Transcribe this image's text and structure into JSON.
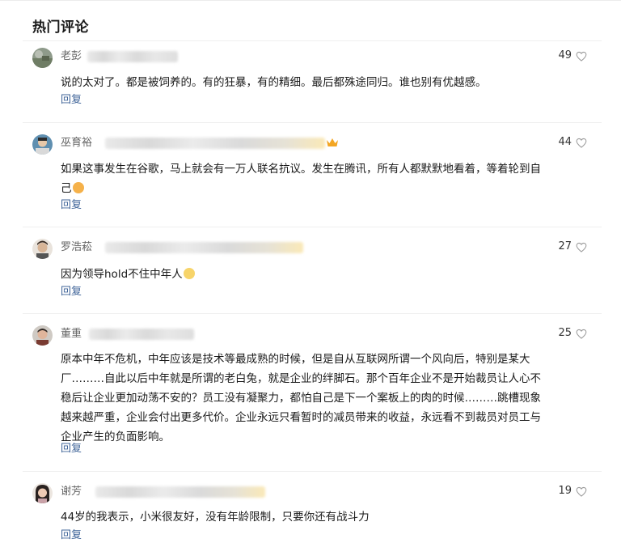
{
  "section": {
    "title": "热门评论"
  },
  "comments": [
    {
      "username": "老彭",
      "likes": "49",
      "content": "说的太对了。都是被饲养的。有的狂暴，有的精细。最后都殊途同归。谁也别有优越感。",
      "reply": "回复"
    },
    {
      "username": "巫育裕",
      "likes": "44",
      "content": "如果这事发生在谷歌，马上就会有一万人联名抗议。发生在腾讯，所有人都默默地看着，等着轮到自己",
      "reply": "回复",
      "badge": "crown-icon",
      "emoji": "crying-face-emoji"
    },
    {
      "username": "罗浩菘",
      "likes": "27",
      "content": "因为领导hold不住中年人",
      "reply": "回复",
      "emoji": "smirk-face-emoji"
    },
    {
      "username": "董重",
      "likes": "25",
      "content": "原本中年不危机，中年应该是技术等最成熟的时候，但是自从互联网所谓一个风向后，特别是某大厂………自此以后中年就是所谓的老白兔，就是企业的绊脚石。那个百年企业不是开始裁员让人心不稳后让企业更加动荡不安的？员工没有凝聚力，都怕自己是下一个案板上的肉的时候………跳槽现象越来越严重，企业会付出更多代价。企业永远只看暂时的减员带来的收益，永远看不到裁员对员工与企业产生的负面影响。",
      "reply": "回复"
    },
    {
      "username": "谢芳",
      "likes": "19",
      "content": "44岁的我表示，小米很友好，没有年龄限制，只要你还有战斗力",
      "reply": "回复"
    }
  ],
  "colors": {
    "reply_link": "#406599",
    "username": "#666666",
    "text": "#1a1a1a"
  }
}
